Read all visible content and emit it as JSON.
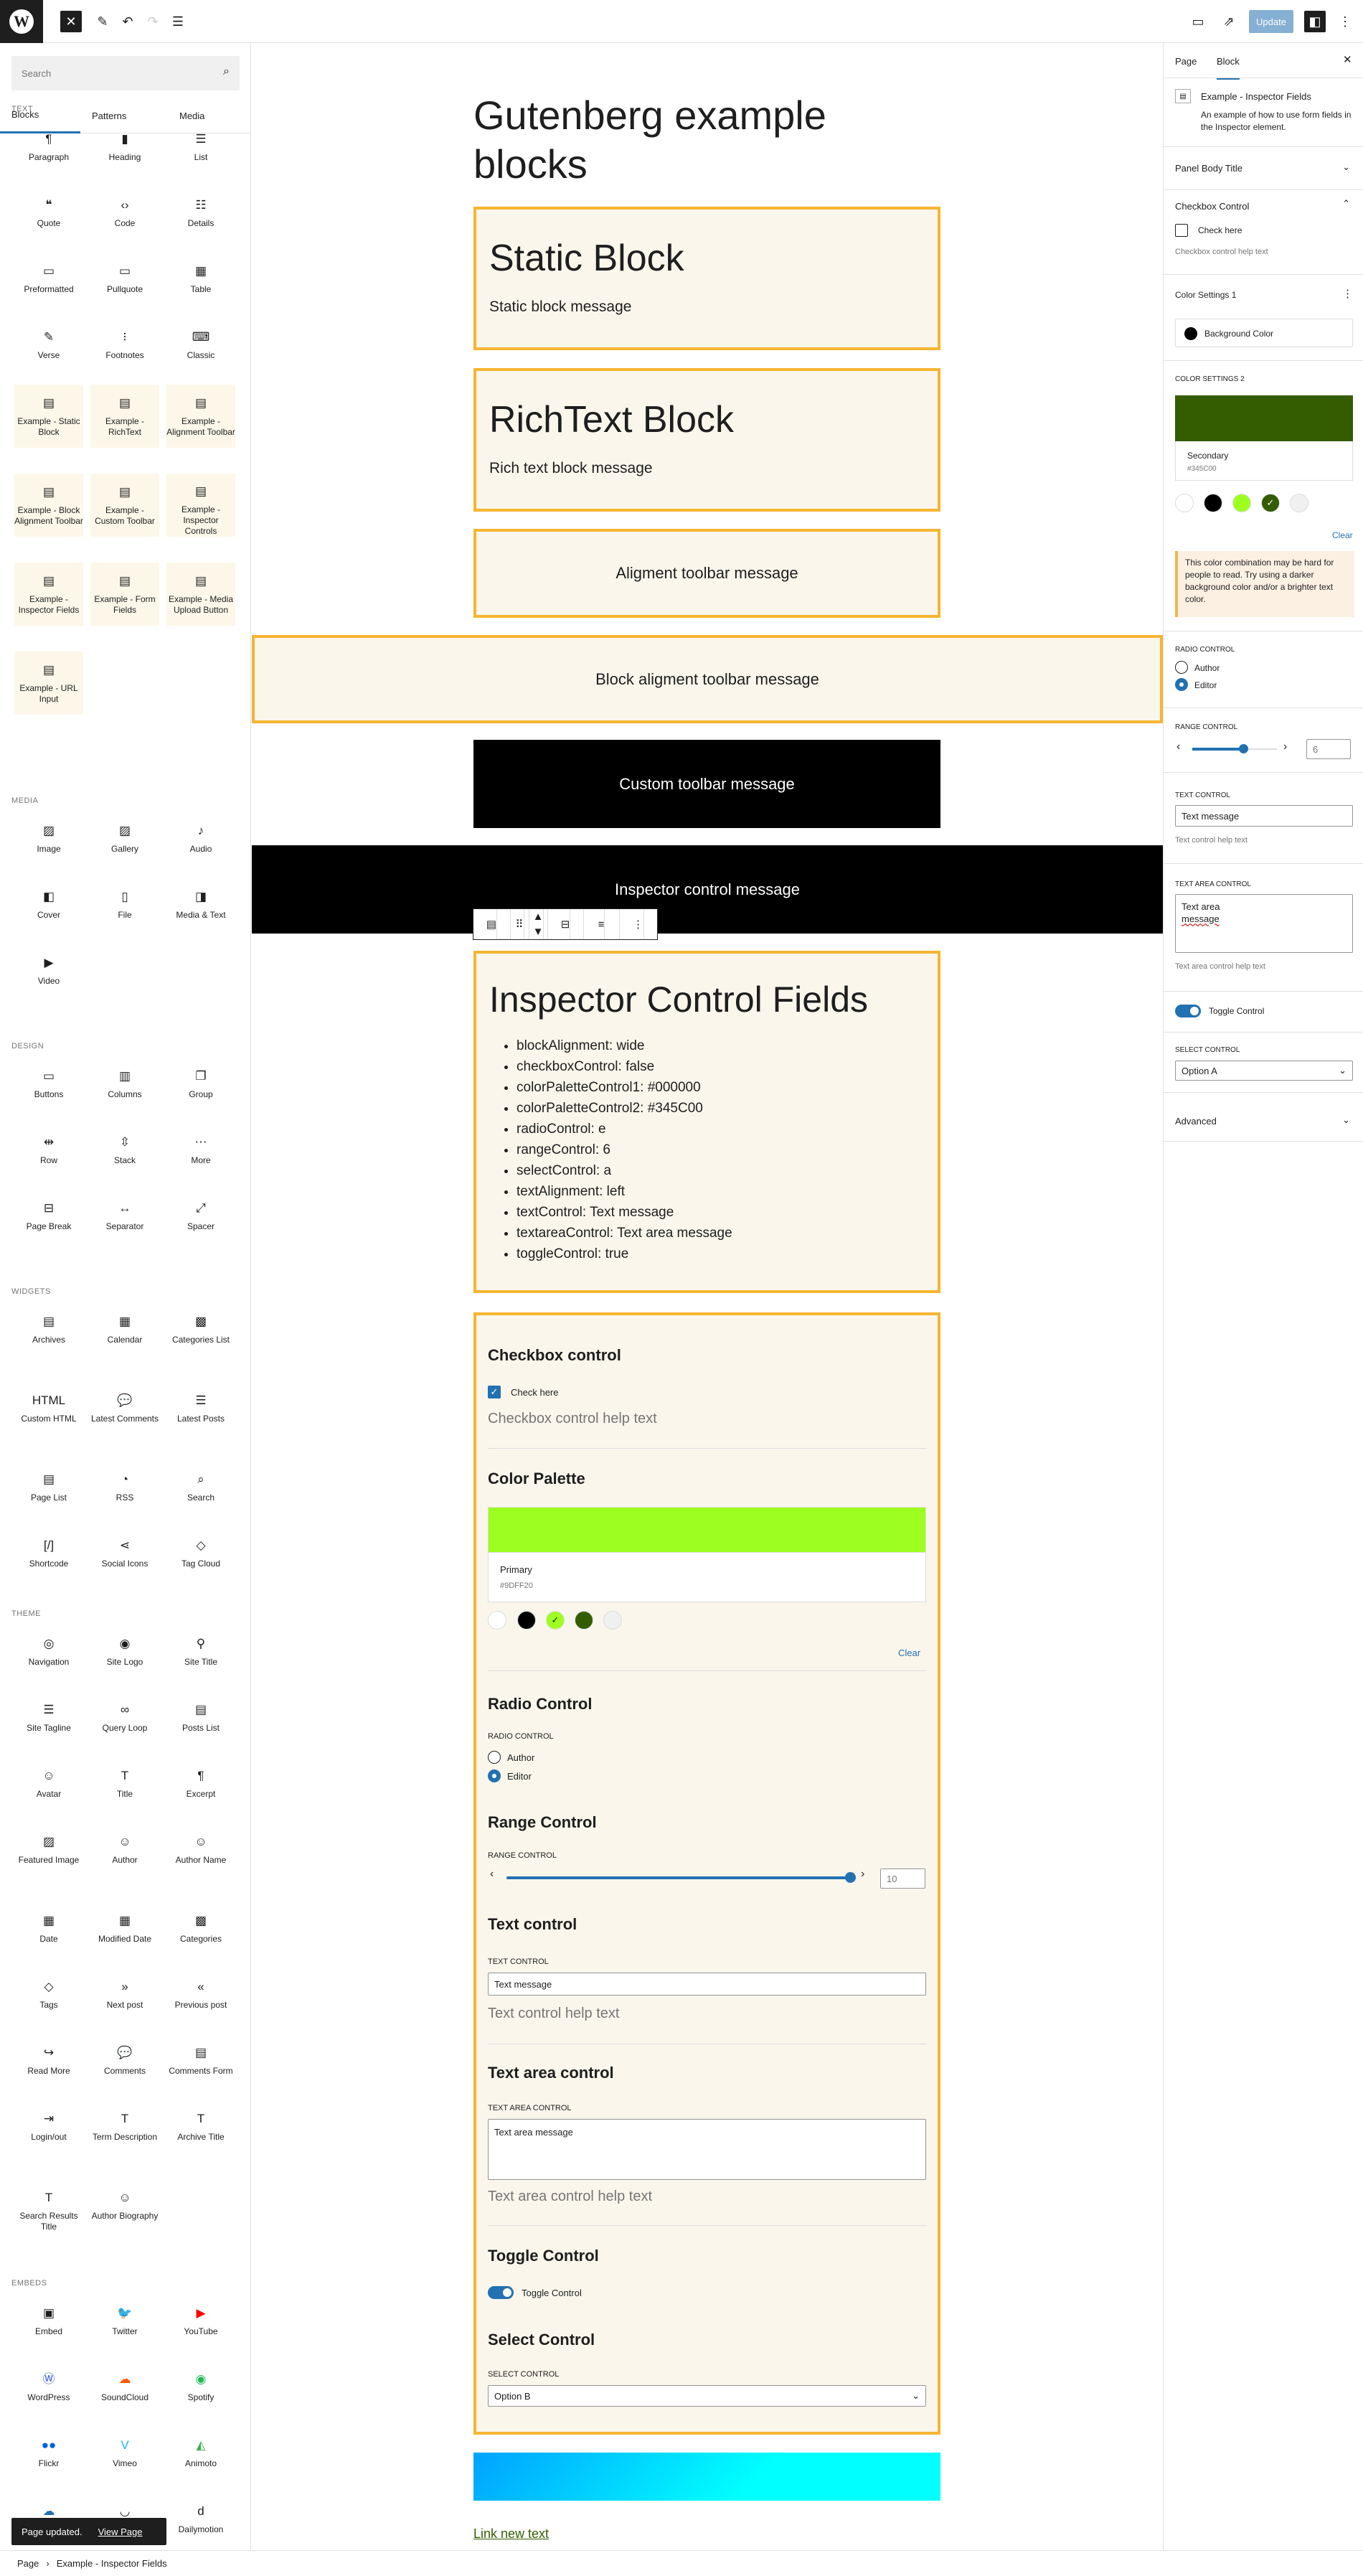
{
  "topbar": {
    "update_label": "Update",
    "logo_letter": "W"
  },
  "left": {
    "search_placeholder": "Search",
    "tabs": [
      "Blocks",
      "Patterns",
      "Media"
    ],
    "categories": {
      "text": "TEXT",
      "media": "MEDIA",
      "design": "DESIGN",
      "widgets": "WIDGETS",
      "theme": "THEME",
      "embeds": "EMBEDS"
    },
    "text_blocks": [
      "Paragraph",
      "Heading",
      "List",
      "Quote",
      "Code",
      "Details",
      "Preformatted",
      "Pullquote",
      "Table",
      "Verse",
      "Footnotes",
      "Classic",
      "Example - Static Block",
      "Example - RichText",
      "Example - Alignment Toolbar",
      "Example - Block Alignment Toolbar",
      "Example - Custom Toolbar",
      "Example - Inspector Controls",
      "Example - Inspector Fields",
      "Example - Form Fields",
      "Example - Media Upload Button",
      "Example - URL Input"
    ],
    "media_blocks": [
      "Image",
      "Gallery",
      "Audio",
      "Cover",
      "File",
      "Media & Text",
      "Video"
    ],
    "design_blocks": [
      "Buttons",
      "Columns",
      "Group",
      "Row",
      "Stack",
      "More",
      "Page Break",
      "Separator",
      "Spacer"
    ],
    "widget_blocks": [
      "Archives",
      "Calendar",
      "Categories List",
      "Custom HTML",
      "Latest Comments",
      "Latest Posts",
      "Page List",
      "RSS",
      "Search",
      "Shortcode",
      "Social Icons",
      "Tag Cloud"
    ],
    "theme_blocks": [
      "Navigation",
      "Site Logo",
      "Site Title",
      "Site Tagline",
      "Query Loop",
      "Posts List",
      "Avatar",
      "Title",
      "Excerpt",
      "Featured Image",
      "Author",
      "Author Name",
      "Date",
      "Modified Date",
      "Categories",
      "Tags",
      "Next post",
      "Previous post",
      "Read More",
      "Comments",
      "Comments Form",
      "Login/out",
      "Term Description",
      "Archive Title",
      "Search Results Title",
      "Author Biography"
    ],
    "embed_blocks": [
      "Embed",
      "Twitter",
      "YouTube",
      "WordPress",
      "SoundCloud",
      "Spotify",
      "Flickr",
      "Vimeo",
      "Animoto",
      "Cloudup",
      "Crowdsignal",
      "Dailymotion"
    ]
  },
  "canvas": {
    "page_title": "Gutenberg example blocks",
    "static_block": {
      "title": "Static Block",
      "message": "Static block message"
    },
    "richtext_block": {
      "title": "RichText Block",
      "message": "Rich text block message"
    },
    "alignment_message": "Aligment toolbar message",
    "block_alignment_message": "Block aligment toolbar message",
    "custom_toolbar_message": "Custom toolbar message",
    "inspector_control_message": "Inspector control message",
    "inspector_fields": {
      "title": "Inspector Control Fields",
      "items": [
        "blockAlignment: wide",
        "checkboxControl: false",
        "colorPaletteControl1: #000000",
        "colorPaletteControl2: #345C00",
        "radioControl: e",
        "rangeControl: 6",
        "selectControl: a",
        "textAlignment: left",
        "textControl: Text message",
        "textareaControl: Text area message",
        "toggleControl: true"
      ]
    },
    "form": {
      "checkbox_heading": "Checkbox control",
      "checkbox_label": "Check here",
      "checkbox_help": "Checkbox control help text",
      "palette_heading": "Color Palette",
      "palette_name": "Primary",
      "palette_hex": "#9DFF20",
      "clear": "Clear",
      "radio_heading": "Radio Control",
      "radio_caption": "RADIO CONTROL",
      "radio_options": [
        "Author",
        "Editor"
      ],
      "range_heading": "Range Control",
      "range_caption": "RANGE CONTROL",
      "range_value": "10",
      "text_heading": "Text control",
      "text_caption": "TEXT CONTROL",
      "text_value": "Text message",
      "text_help": "Text control help text",
      "textarea_heading": "Text area control",
      "textarea_caption": "TEXT AREA CONTROL",
      "textarea_value": "Text area message",
      "textarea_help": "Text area control help text",
      "toggle_heading": "Toggle Control",
      "toggle_label": "Toggle Control",
      "select_heading": "Select Control",
      "select_caption": "SELECT CONTROL",
      "select_value": "Option B"
    },
    "link_text": "Link new text"
  },
  "right": {
    "tabs": [
      "Page",
      "Block"
    ],
    "block_name": "Example - Inspector Fields",
    "block_desc": "An example of how to use form fields in the Inspector element.",
    "panel_body_title": "Panel Body Title",
    "checkbox_panel": "Checkbox Control",
    "checkbox_label": "Check here",
    "checkbox_help": "Checkbox control help text",
    "color_settings_1": "Color Settings 1",
    "background_color": "Background Color",
    "color_settings_2": "COLOR SETTINGS 2",
    "secondary_name": "Secondary",
    "secondary_hex": "#345C00",
    "clear": "Clear",
    "contrast_warning": "This color combination may be hard for people to read. Try using a darker background color and/or a brighter text color.",
    "radio_caption": "RADIO CONTROL",
    "radio_options": [
      "Author",
      "Editor"
    ],
    "range_caption": "RANGE CONTROL",
    "range_value": "6",
    "text_caption": "TEXT CONTROL",
    "text_value": "Text message",
    "text_help": "Text control help text",
    "textarea_caption": "TEXT AREA CONTROL",
    "textarea_value_1": "Text area",
    "textarea_value_2": "message",
    "textarea_help": "Text area control help text",
    "toggle_label": "Toggle Control",
    "select_caption": "SELECT CONTROL",
    "select_value": "Option A",
    "advanced": "Advanced"
  },
  "footer": {
    "breadcrumb_1": "Page",
    "breadcrumb_sep": "›",
    "breadcrumb_2": "Example - Inspector Fields"
  },
  "snackbar": {
    "message": "Page updated.",
    "link": "View Page"
  },
  "colors": {
    "accent": "#2271b1",
    "block_border": "#f5b531",
    "block_bg": "#faf6ec",
    "primary": "#9DFF20",
    "secondary": "#345C00"
  }
}
